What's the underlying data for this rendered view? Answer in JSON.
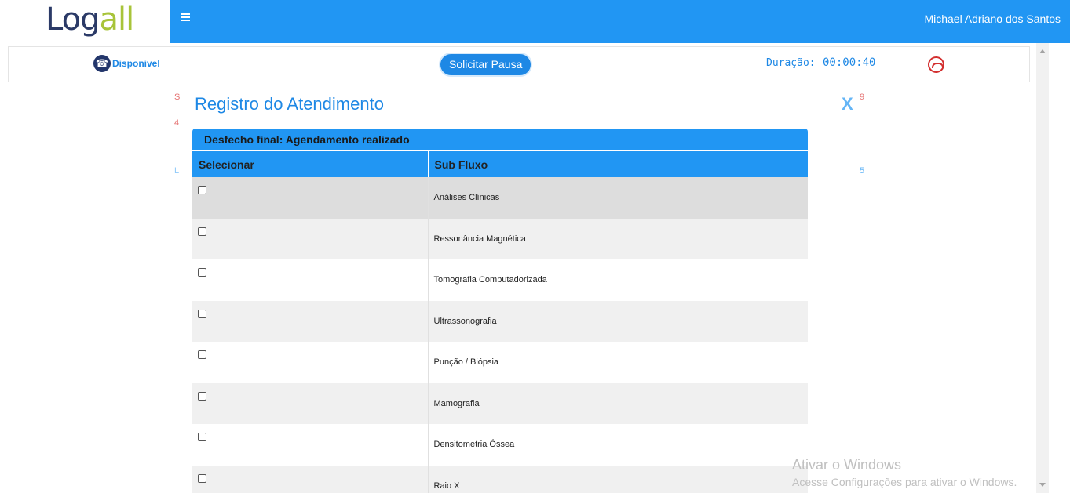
{
  "header": {
    "logo": {
      "part1": "Lo",
      "part2": "g",
      "part3": "all"
    },
    "menu_icon": "hamburger-icon",
    "user_name": "Michael Adriano dos Santos"
  },
  "statusbar": {
    "status_icon": "phone-icon",
    "status_label": "Disponivel",
    "pause_button": "Solicitar Pausa",
    "duration_label": "Duração:",
    "duration_value": "00:00:40",
    "hangup_icon": "hangup-icon",
    "status_color": "#1e88e5",
    "hangup_color": "#d32f2f"
  },
  "background_fragments": {
    "left_top": "S",
    "left_mid": "4",
    "left_bottom": "L",
    "right_top": "9",
    "right_bottom": "5"
  },
  "modal": {
    "title": "Registro do Atendimento",
    "close_label": "X",
    "panel_heading": "Desfecho final: Agendamento realizado",
    "columns": [
      "Selecionar",
      "Sub Fluxo"
    ],
    "rows": [
      "Análises Clínicas",
      "Ressonância Magnética",
      "Tomografia Computadorizada",
      "Ultrassonografia",
      "Punção / Biópsia",
      "Mamografia",
      "Densitometria Óssea",
      "Raio X"
    ]
  },
  "watermark": {
    "title": "Ativar o Windows",
    "subtitle": "Acesse Configurações para ativar o Windows."
  },
  "colors": {
    "accent": "#2196f3",
    "brand_dark": "#2b3a67",
    "brand_green": "#a8c43a"
  }
}
